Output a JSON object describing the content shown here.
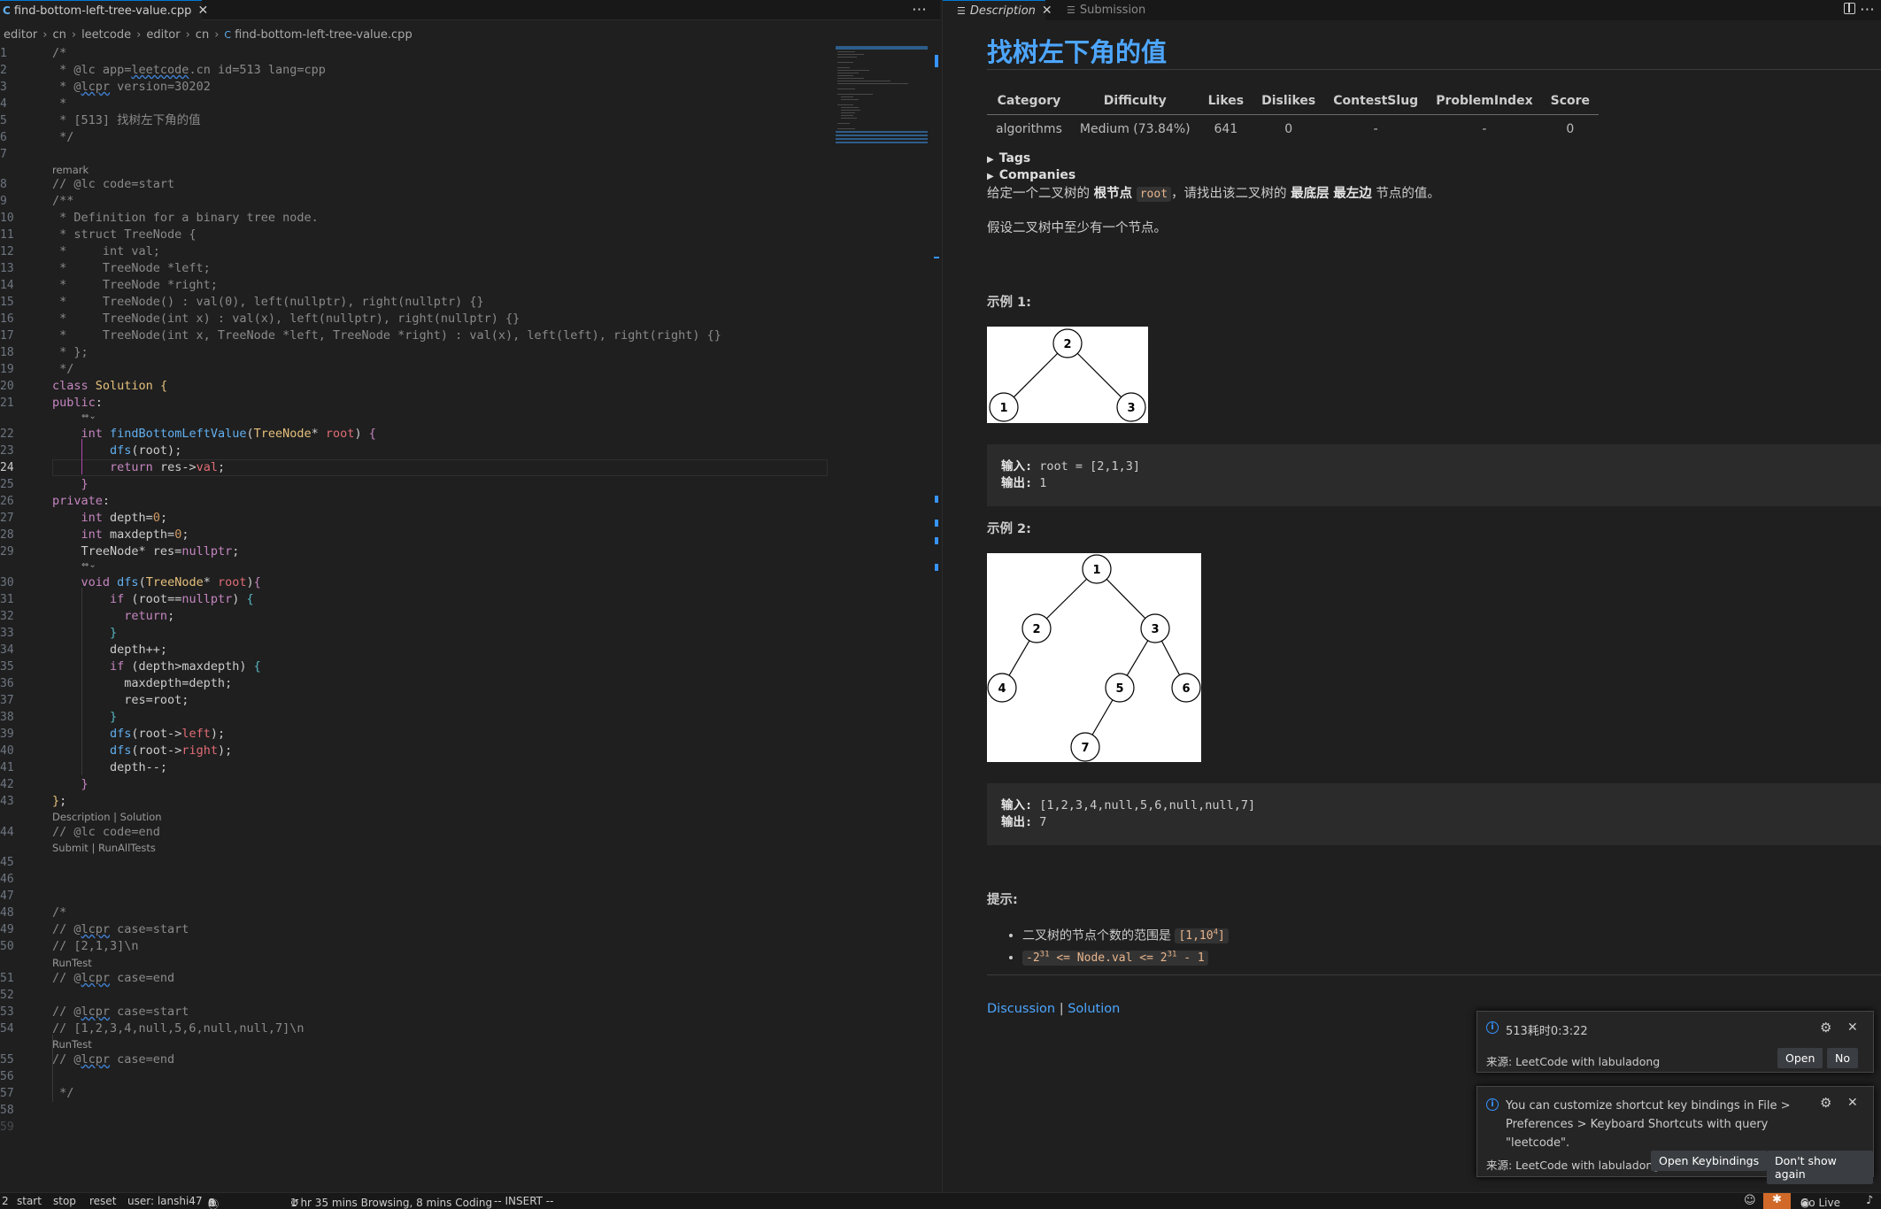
{
  "editor": {
    "tab_label": "find-bottom-left-tree-value.cpp",
    "breadcrumb": [
      "editor",
      "cn",
      "leetcode",
      "editor",
      "cn",
      "find-bottom-left-tree-value.cpp"
    ],
    "code_lenses": {
      "remark": "remark",
      "desc_sol": "Description | Solution",
      "submit_runall": "Submit | RunAllTests",
      "runtest_1": "RunTest",
      "runtest_2": "RunTest"
    },
    "current_line": 24
  },
  "panel": {
    "tabs": [
      "Description",
      "Submission"
    ],
    "problem_title": "找树左下角的值",
    "table_headers": [
      "Category",
      "Difficulty",
      "Likes",
      "Dislikes",
      "ContestSlug",
      "ProblemIndex",
      "Score"
    ],
    "table_row": [
      "algorithms",
      "Medium (73.84%)",
      "641",
      "0",
      "-",
      "-",
      "0"
    ],
    "tags_label": "Tags",
    "companies_label": "Companies",
    "desc_parts": [
      "给定一个二叉树的 ",
      "根节点",
      "root",
      "，请找出该二叉树的 ",
      "最底层",
      "最左边",
      " 节点的值。"
    ],
    "desc2": "假设二叉树中至少有一个节点。",
    "example1_title": "示例 1:",
    "example1_input_label": "输入:",
    "example1_input": " root = [2,1,3]",
    "example1_output_label": "输出:",
    "example1_output": " 1",
    "example2_title": "示例 2:",
    "example2_input_label": "输入:",
    "example2_input": " [1,2,3,4,null,5,6,null,null,7]",
    "example2_output_label": "输出:",
    "example2_output": " 7",
    "hints_title": "提示:",
    "hint1_text": "二叉树的节点个数的范围是 ",
    "hint1_code_pre": "[1,10",
    "hint1_code_sup": "4",
    "hint1_code_post": "]",
    "hint2_pre": "-2",
    "hint2_sup1": "31",
    "hint2_mid": " <= Node.val <= 2",
    "hint2_sup2": "31",
    "hint2_post": " - 1",
    "discussion": "Discussion",
    "link_sep": "|",
    "solution": "Solution",
    "tree1_nodes": [
      "2",
      "1",
      "3"
    ],
    "tree2_nodes": [
      "1",
      "2",
      "3",
      "4",
      "5",
      "6",
      "7"
    ]
  },
  "notifications": [
    {
      "message": "513耗时0:3:22",
      "source": "来源: LeetCode with labuladong",
      "buttons": [
        "Open",
        "No"
      ]
    },
    {
      "message": "You can customize shortcut key bindings in File > Preferences > Keyboard Shortcuts with query \"leetcode\".",
      "source": "来源: LeetCode with labuladong",
      "buttons": [
        "Open Keybindings",
        "Don't show again"
      ]
    }
  ],
  "statusbar": {
    "left_num": "2",
    "start": "start",
    "stop": "stop",
    "reset": "reset",
    "user": "user: lanshi47",
    "problems": "0",
    "warnings": "0",
    "infos": "6",
    "time": "1 hr 35 mins Browsing, 8 mins Coding",
    "mode": "-- INSERT --",
    "golive": "Go Live"
  },
  "colors": {
    "accent": "#4da6ff",
    "info": "#3794ff",
    "statusbar_bg": "#181818",
    "extension_bg": "#d16a28"
  }
}
